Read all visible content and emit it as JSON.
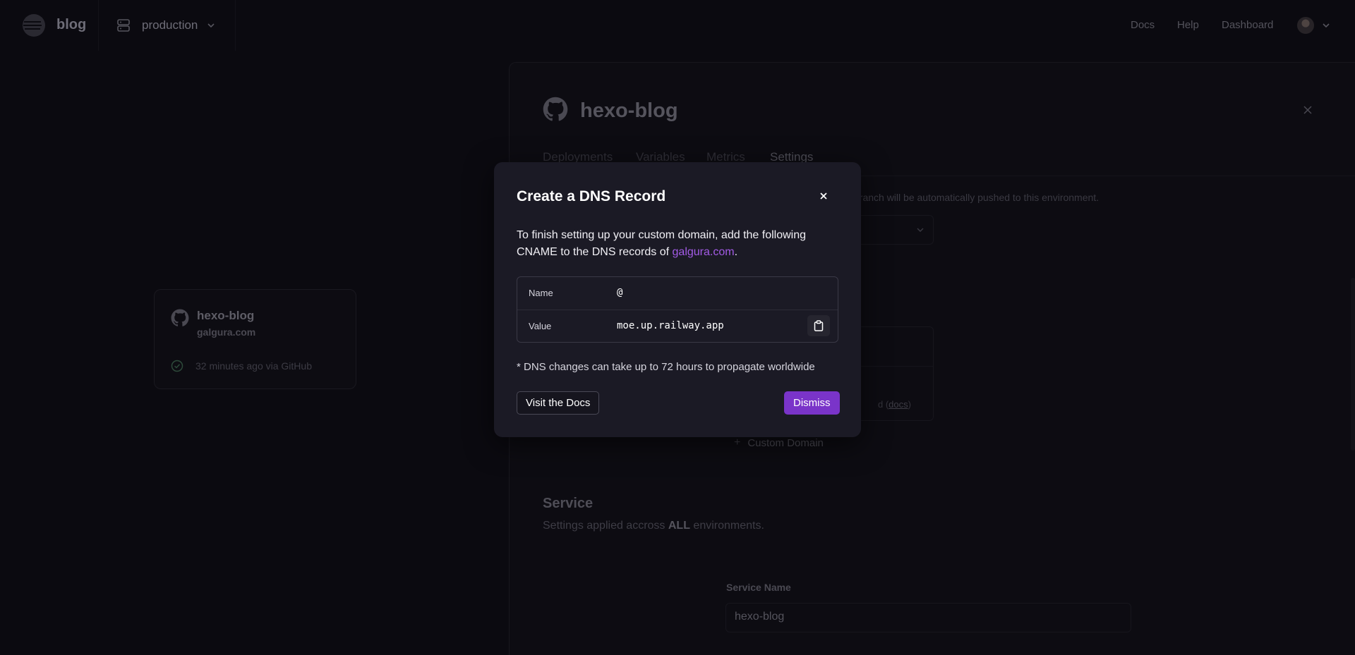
{
  "nav": {
    "project_name": "blog",
    "environment": "production",
    "links": {
      "docs": "Docs",
      "help": "Help",
      "dashboard": "Dashboard"
    }
  },
  "canvas_card": {
    "title": "hexo-blog",
    "domain": "galgura.com",
    "status": "32 minutes ago via GitHub"
  },
  "panel": {
    "title": "hexo-blog",
    "tabs": [
      "Deployments",
      "Variables",
      "Metrics",
      "Settings"
    ],
    "active_tab": "Settings",
    "branch_text": "branch will be automatically pushed to this environment.",
    "domains_note_prefix": "d (",
    "domains_note_link": "docs",
    "domains_note_suffix": ")",
    "add_domain_label": "Custom Domain",
    "service_heading": "Service",
    "service_sub_prefix": "Settings applied accross ",
    "service_sub_bold": "ALL",
    "service_sub_suffix": " environments.",
    "service_name_label": "Service Name",
    "service_name_value": "hexo-blog"
  },
  "modal": {
    "title": "Create a DNS Record",
    "body_prefix": "To finish setting up your custom domain, add the following CNAME to the DNS records of ",
    "body_link": "galgura.com",
    "body_suffix": ".",
    "rows": [
      {
        "label": "Name",
        "value": "@"
      },
      {
        "label": "Value",
        "value": "moe.up.railway.app"
      }
    ],
    "note": "* DNS changes can take up to 72 hours to propagate worldwide",
    "docs_button": "Visit the Docs",
    "dismiss_button": "Dismiss"
  },
  "colors": {
    "accent": "#7a34c9",
    "link": "#a35be6",
    "modal_bg": "#1b1a25",
    "page_bg": "#0b0a10"
  }
}
